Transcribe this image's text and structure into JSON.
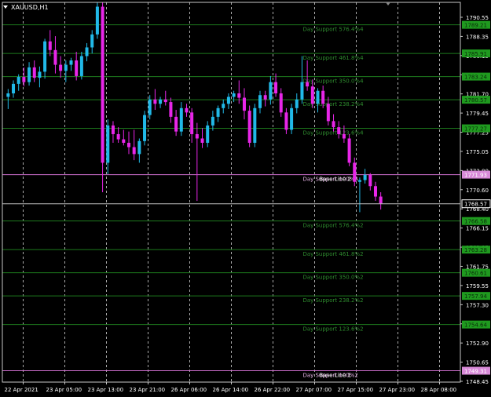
{
  "symbol": "XAUUSD,H1",
  "colors": {
    "background": "#000000",
    "frame": "#c8c8c8",
    "bull": "#21b9e8",
    "bear": "#e826e8",
    "support_line": "#1d7a1d",
    "support_text": "#2e8b2e",
    "support_label_bg": "#1f9a1f",
    "base_line": "#d070d0",
    "base_label_bg": "#d88ad8",
    "current_line": "#c0c0c0",
    "grid": "#c8c8c8"
  },
  "chart_data": {
    "type": "candlestick",
    "ylim": [
      1748.0,
      1791.8
    ],
    "y_ticks": [
      "1790.55",
      "1788.35",
      "1786.15",
      "1783.90",
      "1781.70",
      "1779.45",
      "1777.25",
      "1775.05",
      "1772.80",
      "1770.60",
      "1768.40",
      "1766.15",
      "1763.95",
      "1761.75",
      "1759.55",
      "1757.30",
      "1755.10",
      "1752.90",
      "1750.65",
      "1748.45"
    ],
    "x_ticks": [
      "22 Apr 2021",
      "23 Apr 05:00",
      "23 Apr 13:00",
      "23 Apr 21:00",
      "26 Apr 06:00",
      "26 Apr 14:00",
      "26 Apr 22:00",
      "27 Apr 07:00",
      "27 Apr 15:00",
      "27 Apr 23:00",
      "28 Apr 08:00"
    ],
    "candles": [
      {
        "o": 1780.9,
        "h": 1781.8,
        "l": 1779.5,
        "c": 1781.3
      },
      {
        "o": 1781.3,
        "h": 1782.8,
        "l": 1780.8,
        "c": 1782.4
      },
      {
        "o": 1782.4,
        "h": 1783.5,
        "l": 1781.6,
        "c": 1783.2
      },
      {
        "o": 1783.2,
        "h": 1784.3,
        "l": 1782.1,
        "c": 1782.6
      },
      {
        "o": 1782.6,
        "h": 1784.9,
        "l": 1782.2,
        "c": 1784.3
      },
      {
        "o": 1784.3,
        "h": 1785.1,
        "l": 1782.6,
        "c": 1783.1
      },
      {
        "o": 1783.1,
        "h": 1784.4,
        "l": 1782.0,
        "c": 1783.8
      },
      {
        "o": 1783.8,
        "h": 1787.6,
        "l": 1783.0,
        "c": 1787.3
      },
      {
        "o": 1787.3,
        "h": 1788.6,
        "l": 1785.6,
        "c": 1786.3
      },
      {
        "o": 1786.3,
        "h": 1787.9,
        "l": 1783.6,
        "c": 1784.6
      },
      {
        "o": 1784.6,
        "h": 1785.6,
        "l": 1783.1,
        "c": 1783.9
      },
      {
        "o": 1783.9,
        "h": 1785.1,
        "l": 1782.6,
        "c": 1784.6
      },
      {
        "o": 1784.6,
        "h": 1785.4,
        "l": 1783.9,
        "c": 1785.1
      },
      {
        "o": 1785.1,
        "h": 1786.1,
        "l": 1782.8,
        "c": 1783.3
      },
      {
        "o": 1783.3,
        "h": 1786.1,
        "l": 1782.9,
        "c": 1785.6
      },
      {
        "o": 1785.6,
        "h": 1787.1,
        "l": 1785.0,
        "c": 1786.6
      },
      {
        "o": 1786.6,
        "h": 1788.6,
        "l": 1785.9,
        "c": 1788.1
      },
      {
        "o": 1788.1,
        "h": 1791.8,
        "l": 1787.6,
        "c": 1791.3
      },
      {
        "o": 1791.3,
        "h": 1791.8,
        "l": 1769.9,
        "c": 1773.3
      },
      {
        "o": 1773.3,
        "h": 1778.3,
        "l": 1772.0,
        "c": 1777.6
      },
      {
        "o": 1777.6,
        "h": 1778.1,
        "l": 1775.6,
        "c": 1776.6
      },
      {
        "o": 1776.6,
        "h": 1777.4,
        "l": 1775.6,
        "c": 1776.0
      },
      {
        "o": 1776.0,
        "h": 1777.1,
        "l": 1775.3,
        "c": 1775.6
      },
      {
        "o": 1775.6,
        "h": 1776.9,
        "l": 1774.3,
        "c": 1775.1
      },
      {
        "o": 1775.1,
        "h": 1777.1,
        "l": 1773.6,
        "c": 1774.3
      },
      {
        "o": 1774.3,
        "h": 1776.1,
        "l": 1773.3,
        "c": 1775.8
      },
      {
        "o": 1775.8,
        "h": 1779.3,
        "l": 1775.3,
        "c": 1778.8
      },
      {
        "o": 1778.8,
        "h": 1781.1,
        "l": 1778.3,
        "c": 1780.6
      },
      {
        "o": 1780.6,
        "h": 1781.8,
        "l": 1779.4,
        "c": 1780.1
      },
      {
        "o": 1780.1,
        "h": 1780.9,
        "l": 1779.6,
        "c": 1780.6
      },
      {
        "o": 1780.6,
        "h": 1781.6,
        "l": 1779.9,
        "c": 1780.3
      },
      {
        "o": 1780.3,
        "h": 1780.8,
        "l": 1777.9,
        "c": 1778.6
      },
      {
        "o": 1778.6,
        "h": 1779.4,
        "l": 1776.4,
        "c": 1776.9
      },
      {
        "o": 1776.9,
        "h": 1780.3,
        "l": 1776.4,
        "c": 1779.6
      },
      {
        "o": 1779.6,
        "h": 1780.1,
        "l": 1778.6,
        "c": 1779.1
      },
      {
        "o": 1779.1,
        "h": 1779.6,
        "l": 1775.6,
        "c": 1776.6
      },
      {
        "o": 1776.6,
        "h": 1777.9,
        "l": 1768.9,
        "c": 1776.1
      },
      {
        "o": 1776.1,
        "h": 1777.3,
        "l": 1775.0,
        "c": 1775.6
      },
      {
        "o": 1775.6,
        "h": 1778.1,
        "l": 1775.1,
        "c": 1777.6
      },
      {
        "o": 1777.6,
        "h": 1779.3,
        "l": 1777.0,
        "c": 1778.6
      },
      {
        "o": 1778.6,
        "h": 1779.9,
        "l": 1778.0,
        "c": 1779.6
      },
      {
        "o": 1779.6,
        "h": 1780.6,
        "l": 1779.0,
        "c": 1780.1
      },
      {
        "o": 1780.1,
        "h": 1781.3,
        "l": 1779.5,
        "c": 1780.9
      },
      {
        "o": 1780.9,
        "h": 1781.6,
        "l": 1780.3,
        "c": 1781.3
      },
      {
        "o": 1781.3,
        "h": 1782.8,
        "l": 1780.1,
        "c": 1780.8
      },
      {
        "o": 1780.8,
        "h": 1781.9,
        "l": 1778.3,
        "c": 1779.3
      },
      {
        "o": 1779.3,
        "h": 1779.9,
        "l": 1775.1,
        "c": 1775.6
      },
      {
        "o": 1775.6,
        "h": 1780.1,
        "l": 1775.1,
        "c": 1779.6
      },
      {
        "o": 1779.6,
        "h": 1781.6,
        "l": 1779.0,
        "c": 1781.1
      },
      {
        "o": 1781.1,
        "h": 1781.6,
        "l": 1779.8,
        "c": 1780.6
      },
      {
        "o": 1780.6,
        "h": 1783.3,
        "l": 1780.0,
        "c": 1782.6
      },
      {
        "o": 1782.6,
        "h": 1783.6,
        "l": 1780.9,
        "c": 1781.3
      },
      {
        "o": 1781.3,
        "h": 1781.9,
        "l": 1778.6,
        "c": 1779.1
      },
      {
        "o": 1779.1,
        "h": 1779.6,
        "l": 1776.6,
        "c": 1777.1
      },
      {
        "o": 1777.1,
        "h": 1780.1,
        "l": 1776.6,
        "c": 1779.6
      },
      {
        "o": 1779.6,
        "h": 1781.3,
        "l": 1779.0,
        "c": 1780.6
      },
      {
        "o": 1780.6,
        "h": 1785.6,
        "l": 1780.1,
        "c": 1782.6
      },
      {
        "o": 1782.6,
        "h": 1785.1,
        "l": 1781.6,
        "c": 1782.1
      },
      {
        "o": 1782.1,
        "h": 1782.9,
        "l": 1779.6,
        "c": 1780.1
      },
      {
        "o": 1780.1,
        "h": 1781.9,
        "l": 1779.1,
        "c": 1781.6
      },
      {
        "o": 1781.6,
        "h": 1782.2,
        "l": 1779.6,
        "c": 1780.1
      },
      {
        "o": 1780.1,
        "h": 1780.9,
        "l": 1777.6,
        "c": 1778.1
      },
      {
        "o": 1778.1,
        "h": 1778.9,
        "l": 1776.9,
        "c": 1777.4
      },
      {
        "o": 1777.4,
        "h": 1778.1,
        "l": 1776.1,
        "c": 1776.6
      },
      {
        "o": 1776.6,
        "h": 1777.6,
        "l": 1775.6,
        "c": 1776.1
      },
      {
        "o": 1776.1,
        "h": 1776.6,
        "l": 1772.9,
        "c": 1773.3
      },
      {
        "o": 1773.3,
        "h": 1773.9,
        "l": 1770.6,
        "c": 1771.1
      },
      {
        "o": 1771.1,
        "h": 1771.6,
        "l": 1767.6,
        "c": 1771.3
      },
      {
        "o": 1771.3,
        "h": 1772.6,
        "l": 1770.9,
        "c": 1771.9
      },
      {
        "o": 1771.9,
        "h": 1772.1,
        "l": 1770.1,
        "c": 1770.6
      },
      {
        "o": 1770.6,
        "h": 1771.1,
        "l": 1768.9,
        "c": 1769.4
      },
      {
        "o": 1769.4,
        "h": 1769.9,
        "l": 1767.9,
        "c": 1768.6
      }
    ],
    "levels": [
      {
        "price": 1789.21,
        "label": "Day Support 576.4%4",
        "kind": "support"
      },
      {
        "price": 1785.91,
        "label": "Day Support 461.8%4",
        "kind": "support"
      },
      {
        "price": 1783.24,
        "label": "Day Support 350.0%4",
        "kind": "support"
      },
      {
        "price": 1780.57,
        "label": "Day Support 238.2%4",
        "kind": "support"
      },
      {
        "price": 1777.27,
        "label": "Day Support 123.6%4",
        "kind": "support"
      },
      {
        "price": 1771.93,
        "label": "Day Support 100%4",
        "kind": "base",
        "extra": "Base Line 2"
      },
      {
        "price": 1766.58,
        "label": "Day Support 576.4%2",
        "kind": "support"
      },
      {
        "price": 1763.28,
        "label": "Day Support 461.8%2",
        "kind": "support"
      },
      {
        "price": 1760.61,
        "label": "Day Support 350.0%2",
        "kind": "support"
      },
      {
        "price": 1757.94,
        "label": "Day Support 238.2%2",
        "kind": "support"
      },
      {
        "price": 1754.64,
        "label": "Day Support 123.6%2",
        "kind": "support"
      },
      {
        "price": 1749.31,
        "label": "Day Support 100%2",
        "kind": "base",
        "extra": "Base Line 1"
      }
    ],
    "level_price_labels": [
      "1789.21",
      "1785.91",
      "1783.24",
      "1780.57",
      "1777.27",
      "1771.93",
      "1766.58",
      "1763.28",
      "1760.61",
      "1757.94",
      "1754.64",
      "1749.31"
    ],
    "current_price": 1768.57,
    "current_price_label": "1768.57"
  }
}
